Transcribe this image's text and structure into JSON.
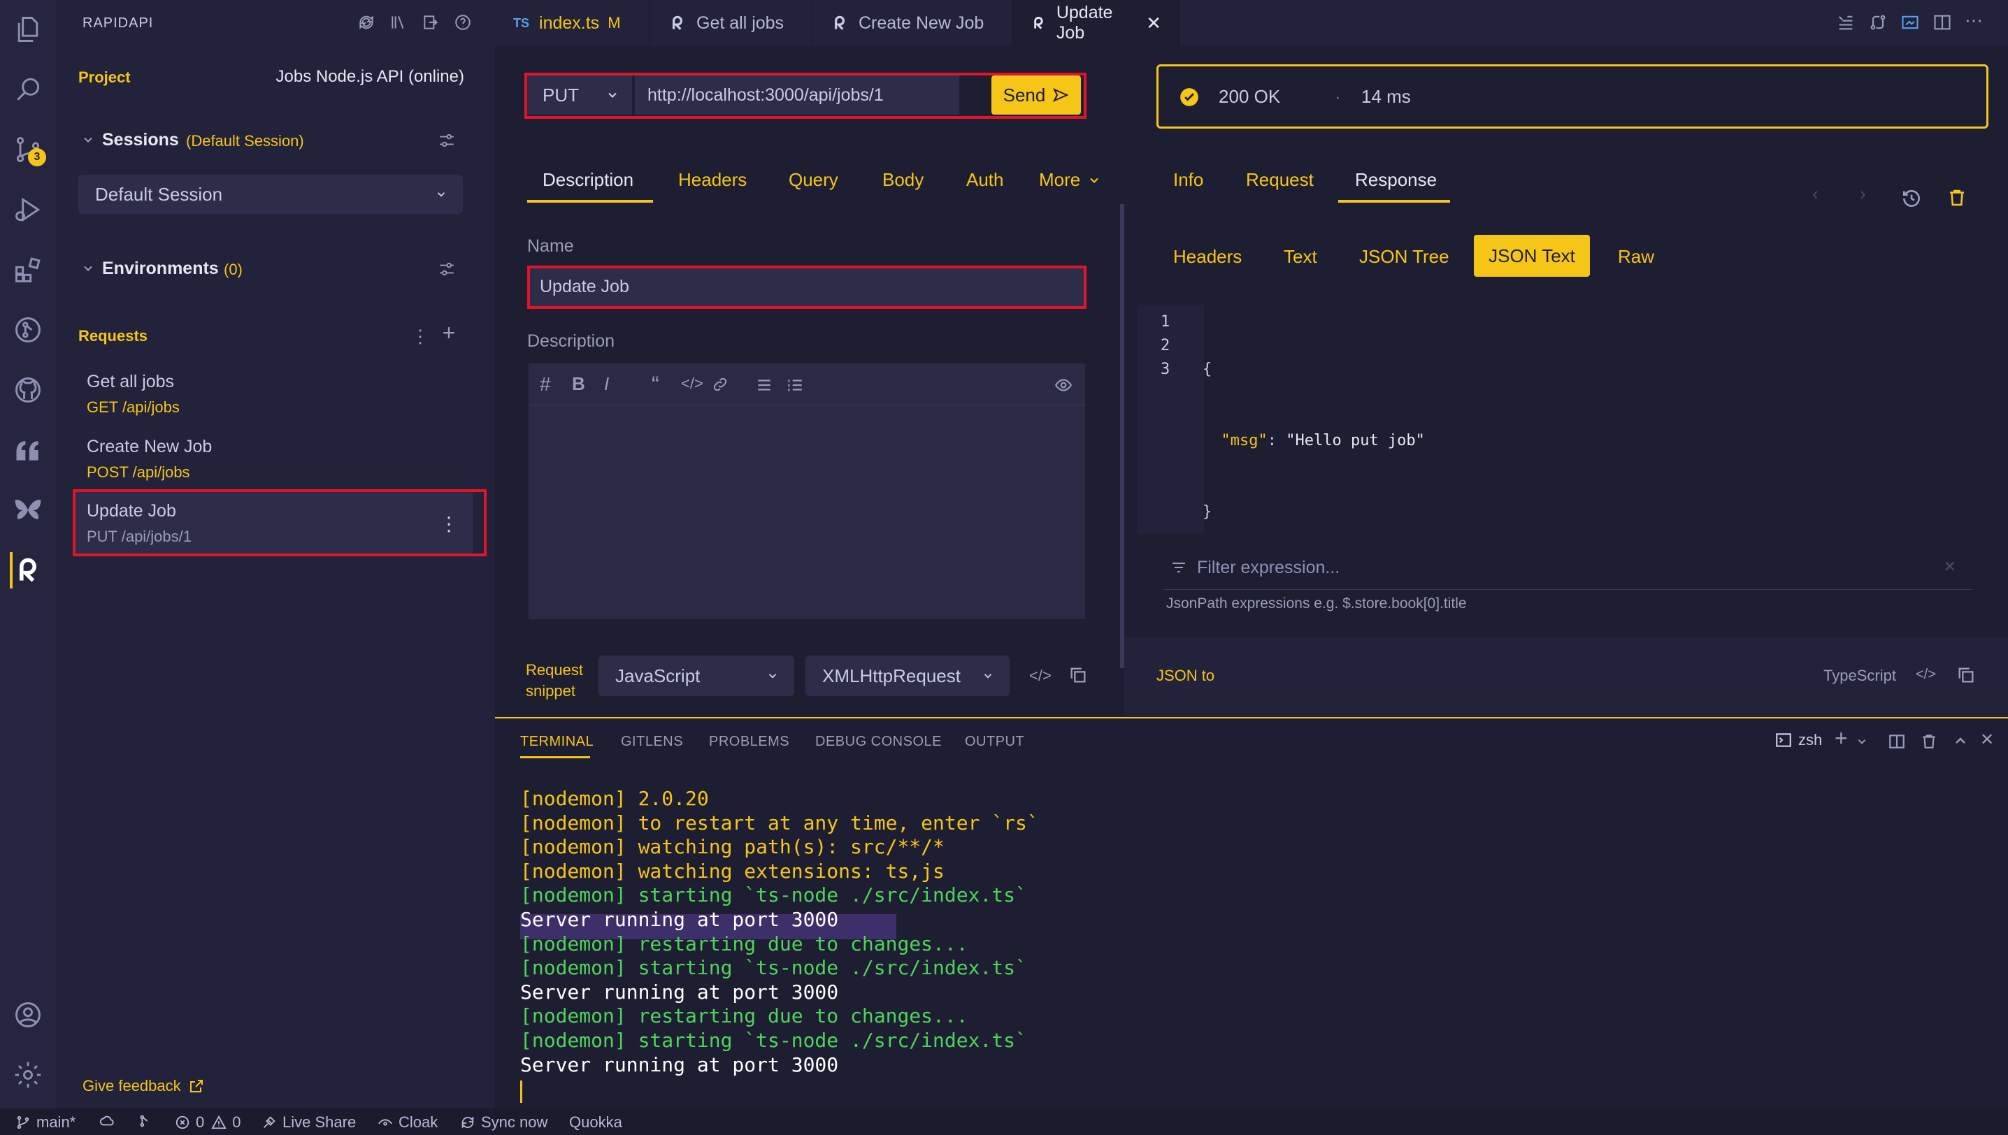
{
  "sidebar": {
    "title": "RAPIDAPI",
    "project_label": "Project",
    "project_name": "Jobs Node.js API (online)",
    "sessions_label": "Sessions",
    "sessions_hint": "(Default Session)",
    "session_selected": "Default Session",
    "environments_label": "Environments",
    "environments_count": "(0)",
    "requests_label": "Requests",
    "requests": [
      {
        "name": "Get all jobs",
        "path": "GET /api/jobs"
      },
      {
        "name": "Create New Job",
        "path": "POST /api/jobs"
      },
      {
        "name": "Update Job",
        "path": "PUT /api/jobs/1"
      }
    ],
    "feedback": "Give feedback",
    "scm_badge": "3"
  },
  "tabs": [
    {
      "label": "index.ts",
      "modified": "M",
      "prefix": "TS"
    },
    {
      "label": "Get all jobs"
    },
    {
      "label": "Create New Job"
    },
    {
      "label": "Update Job"
    }
  ],
  "request": {
    "method": "PUT",
    "url": "http://localhost:3000/api/jobs/1",
    "send_label": "Send",
    "subtabs": [
      "Description",
      "Headers",
      "Query",
      "Body",
      "Auth",
      "More"
    ],
    "name_label": "Name",
    "name_value": "Update Job",
    "description_label": "Description",
    "snippet_label_1": "Request",
    "snippet_label_2": "snippet",
    "snippet_language": "JavaScript",
    "snippet_library": "XMLHttpRequest"
  },
  "response": {
    "status": "200 OK",
    "separator": "·",
    "time": "14 ms",
    "tabs": [
      "Info",
      "Request",
      "Response"
    ],
    "view_tabs": [
      "Headers",
      "Text",
      "JSON Tree",
      "JSON Text",
      "Raw"
    ],
    "lines": [
      {
        "n": "1",
        "text": "{"
      },
      {
        "n": "2",
        "key": "\"msg\"",
        "colon": ": ",
        "value": "\"Hello put job\""
      },
      {
        "n": "3",
        "text": "}"
      }
    ],
    "filter_placeholder": "Filter expression...",
    "filter_hint": "JsonPath expressions e.g. $.store.book[0].title",
    "json_to_label": "JSON to",
    "json_to_target": "TypeScript"
  },
  "terminal": {
    "tabs": [
      "TERMINAL",
      "GITLENS",
      "PROBLEMS",
      "DEBUG CONSOLE",
      "OUTPUT"
    ],
    "shell": "zsh",
    "lines": [
      {
        "text": "[nodemon] 2.0.20",
        "color": "#f5c518"
      },
      {
        "text": "[nodemon] to restart at any time, enter `rs`",
        "color": "#f5c518"
      },
      {
        "text": "[nodemon] watching path(s): src/**/*",
        "color": "#f5c518"
      },
      {
        "text": "[nodemon] watching extensions: ts,js",
        "color": "#f5c518"
      },
      {
        "text": "[nodemon] starting `ts-node ./src/index.ts`",
        "color": "#4ed45a"
      },
      {
        "text": "Server running at port 3000",
        "color": "#ffffff"
      },
      {
        "text": "[nodemon] restarting due to changes...",
        "color": "#4ed45a"
      },
      {
        "text": "[nodemon] starting `ts-node ./src/index.ts`",
        "color": "#4ed45a"
      },
      {
        "text": "Server running at port 3000",
        "color": "#ffffff"
      },
      {
        "text": "[nodemon] restarting due to changes...",
        "color": "#4ed45a"
      },
      {
        "text": "[nodemon] starting `ts-node ./src/index.ts`",
        "color": "#4ed45a"
      },
      {
        "text": "Server running at port 3000",
        "color": "#ffffff"
      }
    ]
  },
  "statusbar": {
    "branch": "main*",
    "errors": "0",
    "warnings": "0",
    "live_share": "Live Share",
    "cloak": "Cloak",
    "sync": "Sync now",
    "quokka": "Quokka"
  },
  "colors": {
    "accent": "#f5c518",
    "highlight": "#e3132a",
    "background": "#1e1e32",
    "success": "#f5c518"
  }
}
